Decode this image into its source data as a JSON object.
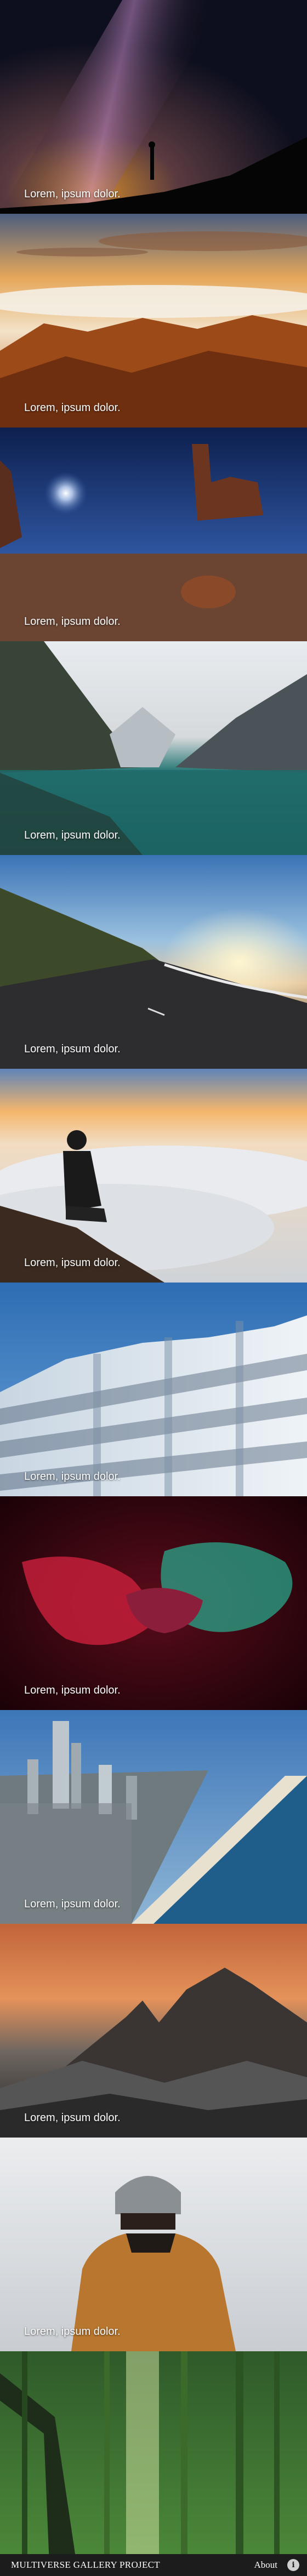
{
  "gallery": {
    "tiles": [
      {
        "caption": "Lorem, ipsum dolor.",
        "scene": "milky-way-silhouette"
      },
      {
        "caption": "Lorem, ipsum dolor.",
        "scene": "sunset-mountains-clouds"
      },
      {
        "caption": "Lorem, ipsum dolor.",
        "scene": "desert-night-rocks"
      },
      {
        "caption": "Lorem, ipsum dolor.",
        "scene": "mountain-lake-reflection"
      },
      {
        "caption": "Lorem, ipsum dolor.",
        "scene": "winding-road-sunset"
      },
      {
        "caption": "Lorem, ipsum dolor.",
        "scene": "man-above-clouds"
      },
      {
        "caption": "Lorem, ipsum dolor.",
        "scene": "modern-building"
      },
      {
        "caption": "Lorem, ipsum dolor.",
        "scene": "red-green-hands"
      },
      {
        "caption": "Lorem, ipsum dolor.",
        "scene": "coastal-city-beach"
      },
      {
        "caption": "Lorem, ipsum dolor.",
        "scene": "misty-mountain-peaks"
      },
      {
        "caption": "Lorem, ipsum dolor.",
        "scene": "person-in-beanie"
      },
      {
        "caption": "",
        "scene": "bamboo-forest"
      }
    ]
  },
  "footer": {
    "brand": "MULTIVERSE GALLERY PROJECT",
    "about_label": "About",
    "info_icon": "info-icon"
  }
}
